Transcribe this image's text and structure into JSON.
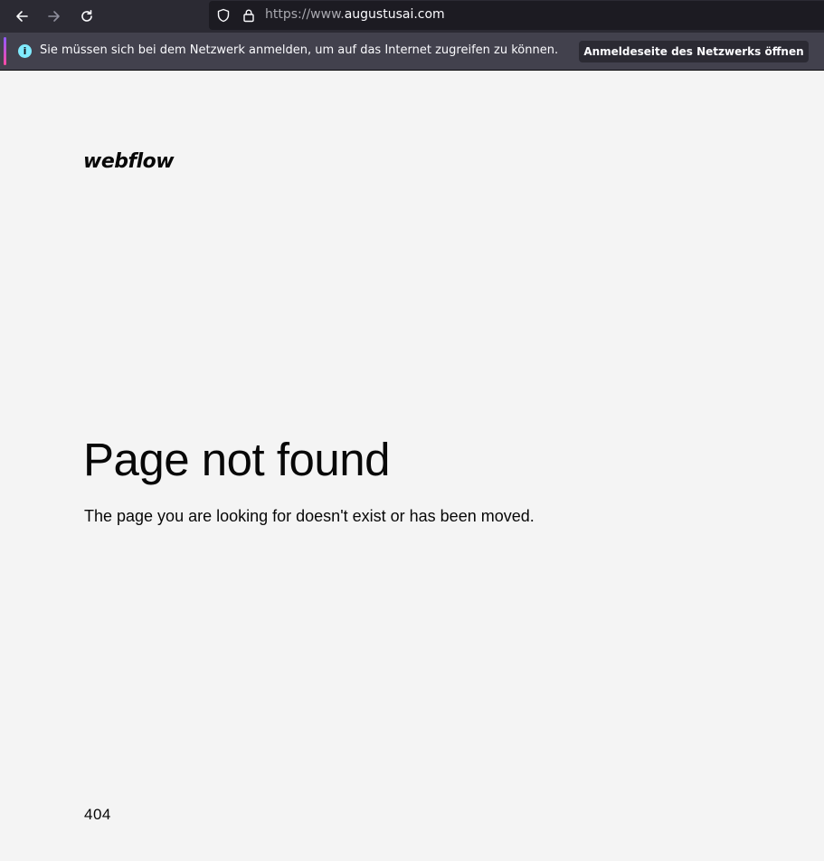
{
  "browser": {
    "url_prefix": "https://www.",
    "url_domain": "augustusai.com",
    "icons": {
      "back": "arrow-left-icon",
      "forward": "arrow-right-icon",
      "reload": "reload-icon",
      "tracking_protection": "shield-icon",
      "secure": "lock-icon"
    }
  },
  "notification": {
    "icon": "info-icon",
    "icon_glyph": "i",
    "message": "Sie müssen sich bei dem Netzwerk anmelden, um auf das Internet zugreifen zu können.",
    "button_label": "Anmeldeseite des Netzwerks öffnen"
  },
  "page": {
    "logo": "webflow",
    "title": "Page not found",
    "subtitle": "The page you are looking for doesn't exist or has been moved.",
    "error_code": "404"
  },
  "colors": {
    "toolbar_bg": "#2b2a33",
    "urlbar_bg": "#1c1b22",
    "notification_bg": "#42414d",
    "info_accent": "#80ebff",
    "page_bg": "#f4f4f4",
    "text": "#080808"
  }
}
